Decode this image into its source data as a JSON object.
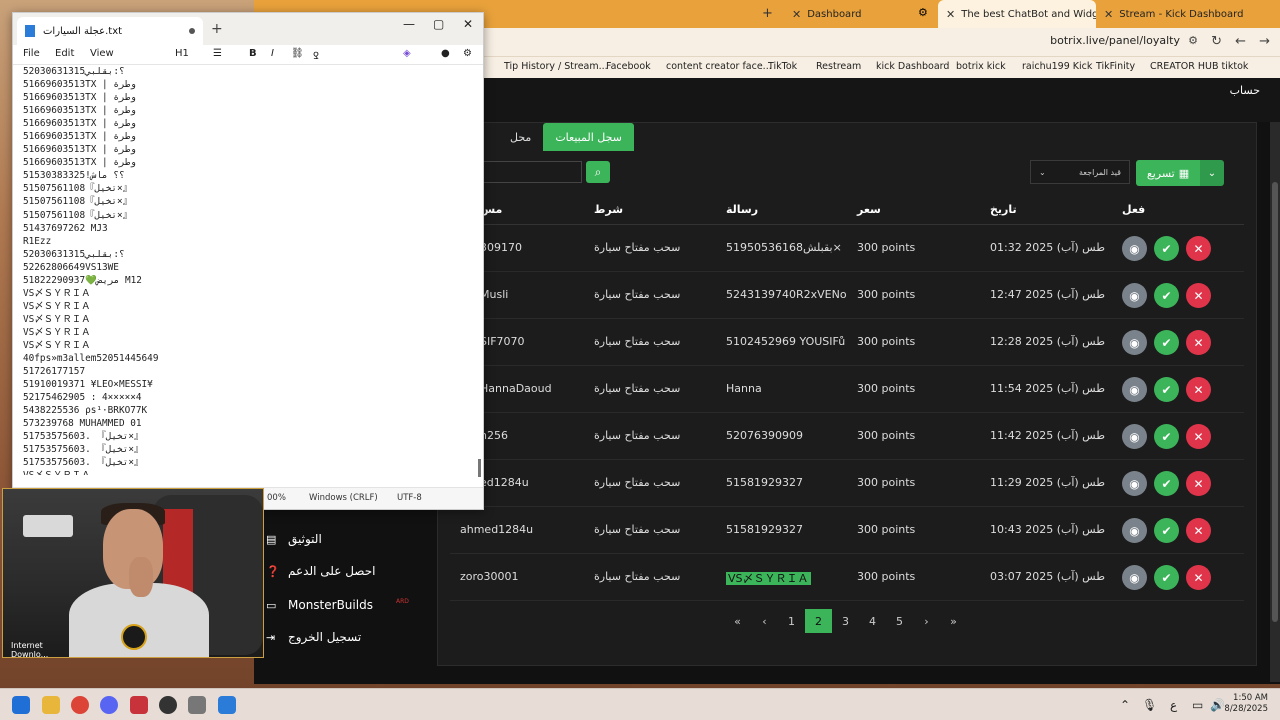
{
  "browser": {
    "tabs": [
      {
        "label": "Dashboard",
        "active": false
      },
      {
        "label": "The best ChatBot and Widgets",
        "active": true
      },
      {
        "label": "Stream - Kick Dashboard",
        "active": false
      }
    ],
    "url": "botrix.live/panel/loyalty",
    "bookmarks": [
      "Tip History / Stream...",
      "Facebook",
      "content creator face...",
      "TikTok",
      "Restream",
      "kick Dashboard",
      "botrix kick",
      "raichu199 Kick",
      "TikFinity",
      "CREATOR HUB tiktok"
    ]
  },
  "app": {
    "account_label": "حساب",
    "tabs": [
      "محل",
      "سجل المبيعات"
    ],
    "filter_select": "قيد المراجعة",
    "export_label": "تسريع",
    "columns": {
      "user": "مس",
      "condition": "شرط",
      "message": "رسالة",
      "price": "سعر",
      "date": "تاريخ",
      "action": "فعل"
    },
    "rows": [
      {
        "user": "309170",
        "condition": "سحب مفتاح سيارة",
        "message": "51950536168بقبلش×",
        "price": "300 points",
        "date": "01:32 2025 طس (آب)",
        "highlight": false
      },
      {
        "user": "Musli",
        "condition": "سحب مفتاح سيارة",
        "message": "5243139740R2xVENoM",
        "price": "300 points",
        "date": "12:47 2025 طس (آب)",
        "highlight": false
      },
      {
        "user": "SIF7070",
        "condition": "سحب مفتاح سيارة",
        "message": "5102452969 YOUSIFů...",
        "price": "300 points",
        "date": "12:28 2025 طس (آب)",
        "highlight": false
      },
      {
        "user": "HannaDaoud",
        "condition": "سحب مفتاح سيارة",
        "message": "Hanna",
        "price": "300 points",
        "date": "11:54 2025 طس (آب)",
        "highlight": false
      },
      {
        "user": "n256",
        "condition": "سحب مفتاح سيارة",
        "message": "52076390909",
        "price": "300 points",
        "date": "11:42 2025 طس (آب)",
        "highlight": false
      },
      {
        "user": "ed1284u",
        "condition": "سحب مفتاح سيارة",
        "message": "51581929327",
        "price": "300 points",
        "date": "11:29 2025 طس (آب)",
        "highlight": false
      },
      {
        "user": "ahmed1284u",
        "condition": "سحب مفتاح سيارة",
        "message": "51581929327",
        "price": "300 points",
        "date": "10:43 2025 طس (آب)",
        "highlight": false
      },
      {
        "user": "zoro30001",
        "condition": "سحب مفتاح سيارة",
        "message": "VS〆ＳＹＲＩＡ",
        "price": "300 points",
        "date": "03:07 2025 طس (آب)",
        "highlight": true
      }
    ],
    "pagination": {
      "pages": [
        "1",
        "2",
        "3",
        "4",
        "5"
      ],
      "current": "2"
    },
    "sidebar": [
      {
        "label": "التوثيق",
        "icon": "document-icon"
      },
      {
        "label": "احصل على الدعم",
        "icon": "help-icon"
      },
      {
        "label": "MonsterBuilds",
        "icon": "monitor-icon"
      },
      {
        "label": "تسجيل الخروج",
        "icon": "logout-icon"
      }
    ],
    "sidebar_tag": "ARD"
  },
  "notepad": {
    "title": "عجلة السيارات.txt",
    "menu": {
      "file": "File",
      "edit": "Edit",
      "view": "View",
      "heading": "H1"
    },
    "content": "52030631315؟:بقلبي\n51669603513TX | وطرة\n51669603513TX | وطرة\n51669603513TX | وطرة\n51669603513TX | وطرة\n51669603513TX | وطرة\n51669603513TX | وطرة\n51669603513TX | وطرة\n51530383325!؟؟ ماش\n51507561108『تخيل×』\n51507561108『تخيل×』\n51507561108『تخيل×』\n51437697262 MJ3\nR1Ezz\n52030631315؟:بقلبي\n52262806649VS13WE\n51822290937💚مريض M12\nVS〆ＳＹＲＩＡ\nVS〆ＳＹＲＩＡ\nVS〆ＳＹＲＩＡ\nVS〆ＳＹＲＩＡ\nVS〆ＳＹＲＩＡ\n40fps»m3allem52051445649\n51726177157\n51910019371 ¥LEO×MESSI¥\n52175462905 : 4×××××4\n5438225536 ρs¹·BRKO77K\n573239768 MUHAMMED 01\n51753575603. 『تخيل×』\n51753575603. 『تخيل×』\n51753575603. 『تخيل×』\nVS〆ＳＹＲＩＡ",
    "status": {
      "zoom": "00%",
      "line_ending": "Windows (CRLF)",
      "encoding": "UTF-8"
    }
  },
  "webcam": {
    "overlay_text": "Internet\nDownlo..."
  },
  "taskbar": {
    "time": "1:50 AM",
    "date": "8/28/2025",
    "lang": "ع"
  }
}
